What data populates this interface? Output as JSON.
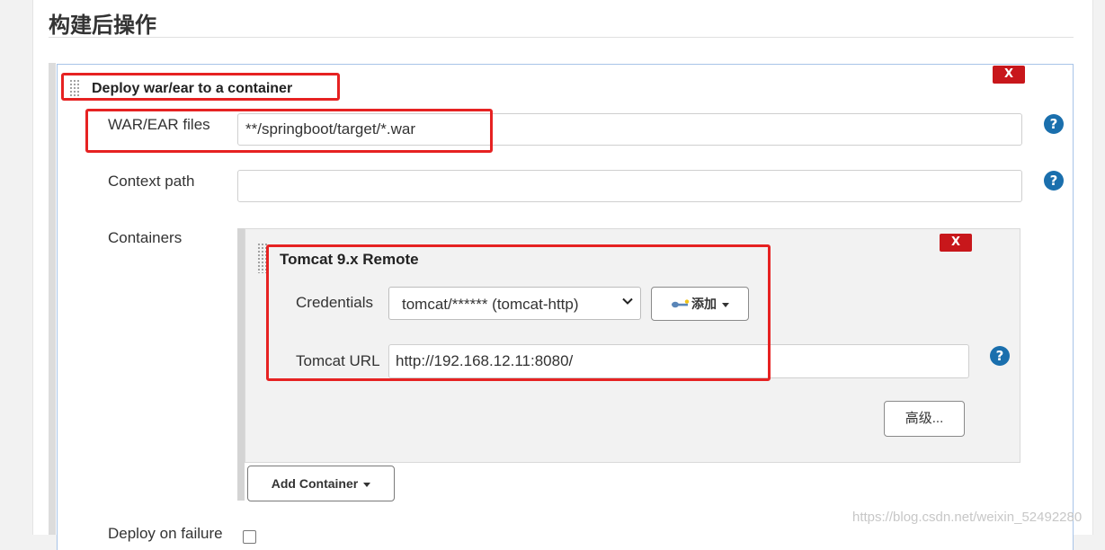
{
  "section": {
    "title": "构建后操作"
  },
  "deploy": {
    "title": "Deploy war/ear to a container",
    "delete_label": "X",
    "war_ear": {
      "label": "WAR/EAR files",
      "value": "**/springboot/target/*.war"
    },
    "context_path": {
      "label": "Context path",
      "value": ""
    },
    "containers": {
      "label": "Containers"
    },
    "on_failure": {
      "label": "Deploy on failure",
      "checked": false
    }
  },
  "container": {
    "title": "Tomcat 9.x Remote",
    "delete_label": "X",
    "credentials": {
      "label": "Credentials",
      "selected": "tomcat/****** (tomcat-http)"
    },
    "add_button": {
      "label": "添加",
      "icon": "key-icon"
    },
    "tomcat_url": {
      "label": "Tomcat URL",
      "value": "http://192.168.12.11:8080/"
    },
    "advanced_button": {
      "label": "高级..."
    }
  },
  "add_container_button": {
    "label": "Add Container"
  },
  "help_icon_glyph": "?",
  "watermark": "https://blog.csdn.net/weixin_52492280",
  "colors": {
    "delete": "#c8171b",
    "help": "#1a6fad",
    "annotation": "#e62222",
    "panel_border": "#a8c4e8"
  }
}
